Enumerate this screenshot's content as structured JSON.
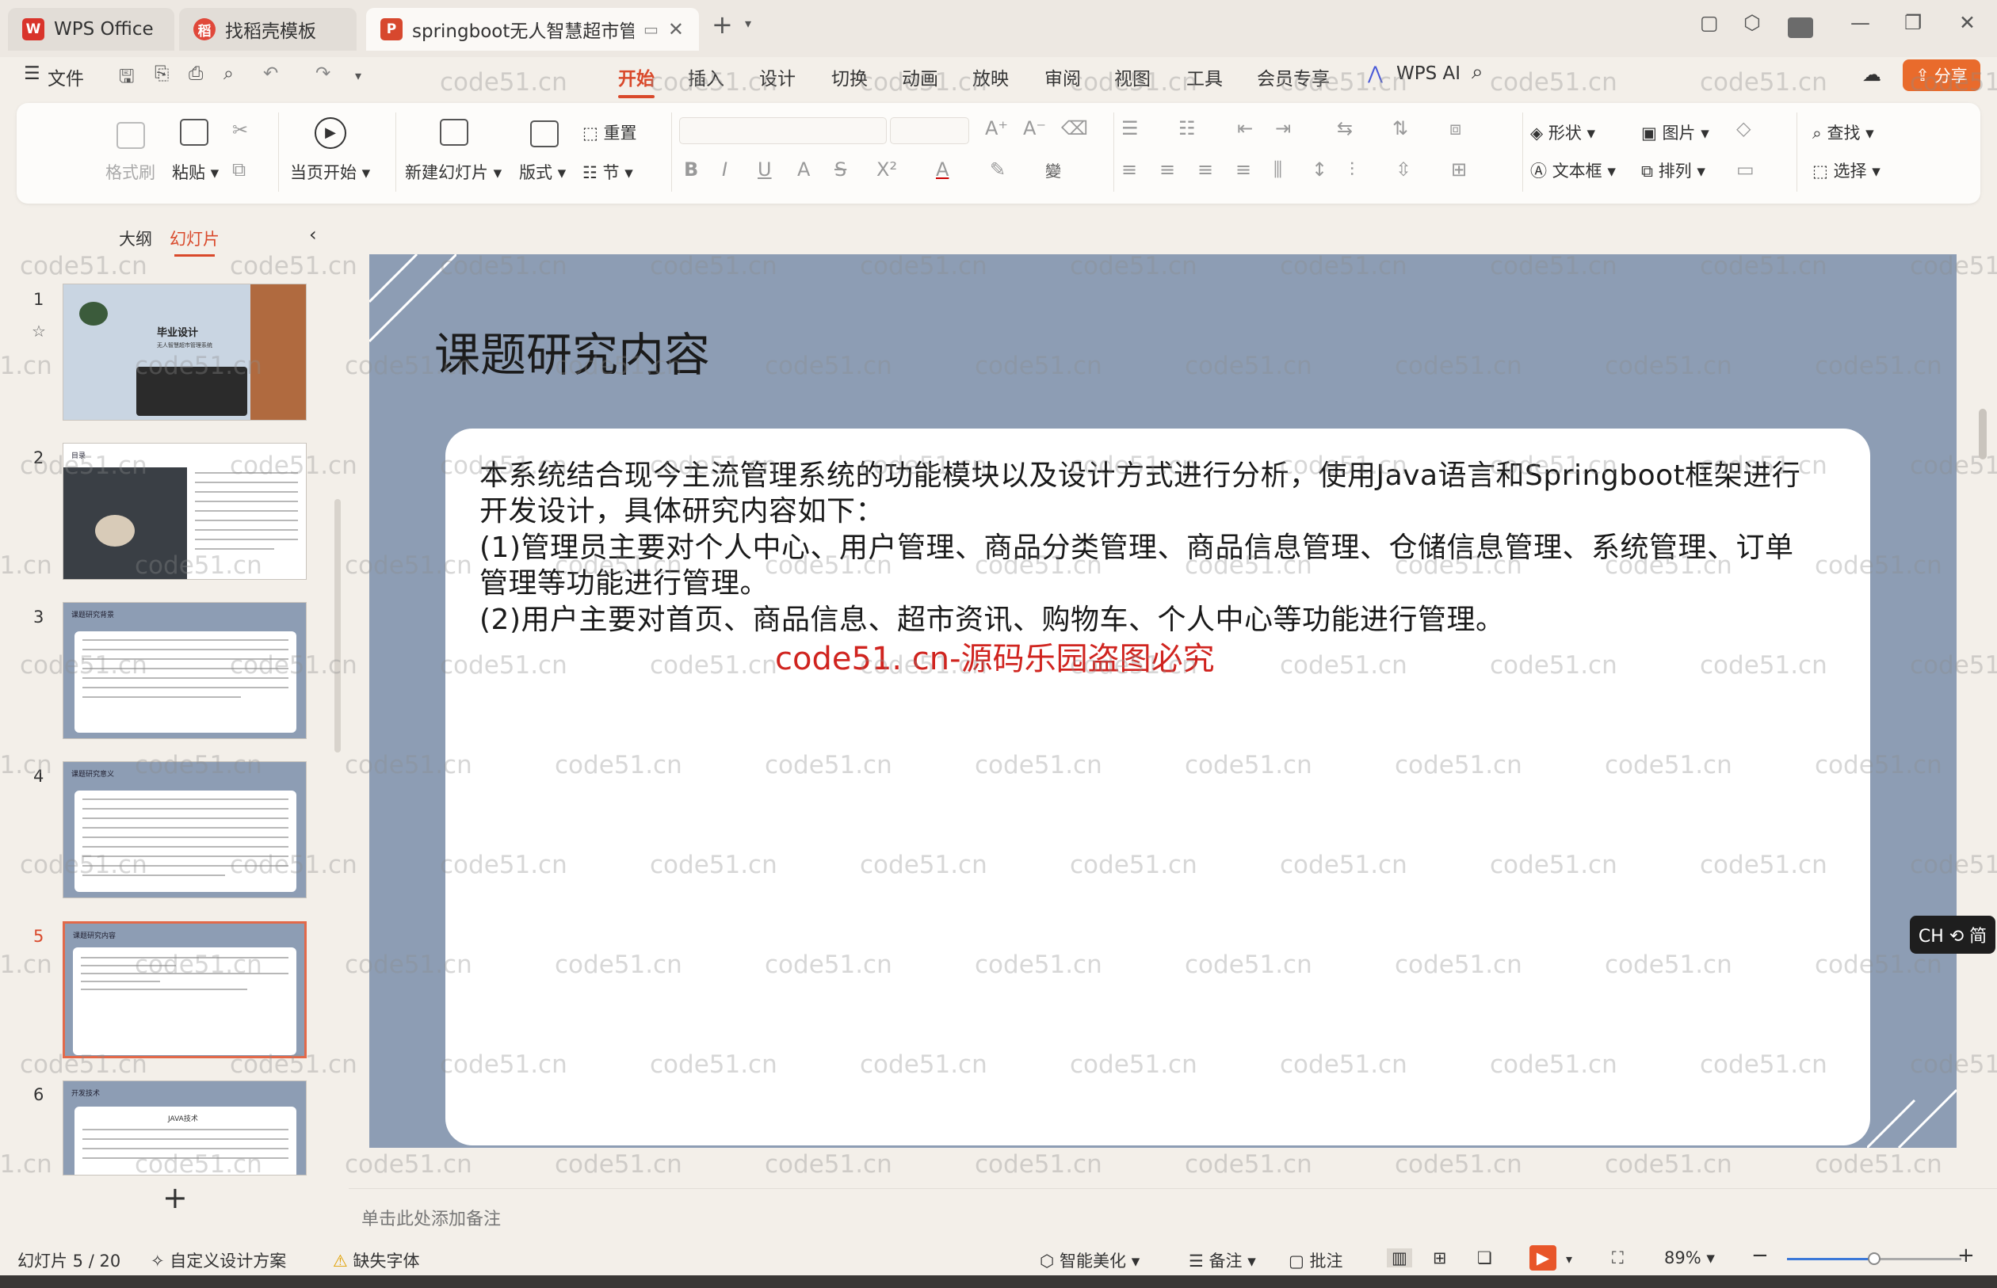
{
  "titlebar": {
    "tabs": [
      {
        "label": "WPS Office",
        "logo": "W",
        "logo_color": "#d9342b"
      },
      {
        "label": "找稻壳模板",
        "logo": "稻",
        "logo_color": "#e0483a"
      },
      {
        "label": "springboot无人智慧超市管理",
        "logo": "P",
        "logo_color": "#d7482e"
      }
    ],
    "new_tab": "+",
    "icons": [
      "tab-close-icon",
      "new-tab-icon",
      "minimize-icon",
      "maximize-icon",
      "close-icon"
    ]
  },
  "menubar": {
    "file": "文件",
    "tabs": [
      "开始",
      "插入",
      "设计",
      "切换",
      "动画",
      "放映",
      "审阅",
      "视图",
      "工具",
      "会员专享",
      "WPS AI"
    ],
    "active_tab": "开始",
    "share": "分享",
    "accent": "#d9492b"
  },
  "ribbon": {
    "format_painter": "格式刷",
    "paste": "粘贴",
    "from_current": "当页开始",
    "new_slide": "新建幻灯片",
    "layout": "版式",
    "reset": "重置",
    "section": "节",
    "shape": "形状",
    "picture": "图片",
    "textbox": "文本框",
    "arrange": "排列",
    "find": "查找",
    "select": "选择"
  },
  "leftpanel": {
    "tab_outline": "大纲",
    "tab_slides": "幻灯片",
    "thumbnails": [
      {
        "num": "1",
        "title": "毕业设计",
        "subtitle": "无人智慧超市管理系统"
      },
      {
        "num": "2",
        "title": "目录"
      },
      {
        "num": "3",
        "title": "课题研究背景"
      },
      {
        "num": "4",
        "title": "课题研究意义"
      },
      {
        "num": "5",
        "title": "课题研究内容"
      },
      {
        "num": "6",
        "title": "开发技术",
        "subtitle": "JAVA技术"
      }
    ],
    "active_index": 4
  },
  "slide": {
    "title": "课题研究内容",
    "lines": [
      "本系统结合现今主流管理系统的功能模块以及设计方式进行分析，使用Java语言和Springboot框架进行",
      "开发设计，具体研究内容如下：",
      "(1)管理员主要对个人中心、用户管理、商品分类管理、商品信息管理、仓储信息管理、系统管理、订单",
      "管理等功能进行管理。",
      "(2)用户主要对首页、商品信息、超市资讯、购物车、个人中心等功能进行管理。"
    ],
    "red_watermark": "code51. cn-源码乐园盗图必究",
    "watermark": "code51.cn"
  },
  "notes": {
    "placeholder": "单击此处添加备注"
  },
  "statusbar": {
    "slide_counter": "幻灯片 5 / 20",
    "design_scheme": "自定义设计方案",
    "missing_font": "缺失字体",
    "beautify": "智能美化",
    "notes": "备注",
    "comments": "批注",
    "zoom": "89%",
    "zoom_fraction": 0.5
  },
  "ime": {
    "label": "CH ⟲ 简"
  }
}
